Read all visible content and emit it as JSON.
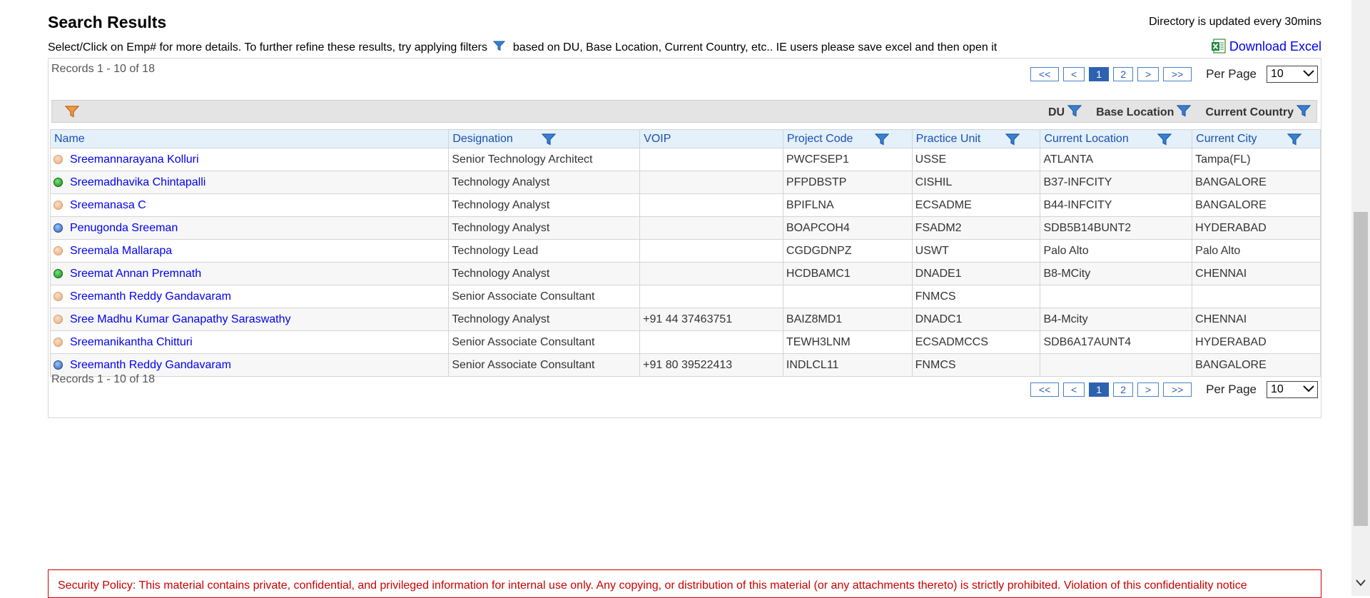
{
  "header": {
    "title": "Search Results",
    "updated_note": "Directory is updated every 30mins",
    "instructions_before": "Select/Click on Emp# for more details. To further refine these results, try applying filters",
    "instructions_after": "based on DU, Base Location, Current Country, etc.. IE users please save excel and then open it",
    "download_label": "Download Excel"
  },
  "pagination": {
    "records_text": "Records 1 - 10 of 18",
    "first": "<<",
    "prev": "<",
    "pages": [
      "1",
      "2"
    ],
    "active_page": "1",
    "next": ">",
    "last": ">>",
    "per_page_label": "Per Page",
    "per_page_value": "10"
  },
  "filter_bar": {
    "labels": [
      "DU",
      "Base Location",
      "Current Country"
    ]
  },
  "table": {
    "columns": [
      "Name",
      "Designation",
      "VOIP",
      "Project Code",
      "Practice Unit",
      "Current Location",
      "Current City"
    ],
    "rows": [
      {
        "status": "away",
        "name": "Sreemannarayana Kolluri",
        "designation": "Senior Technology Architect",
        "voip": "",
        "project": "PWCFSEP1",
        "unit": "USSE",
        "location": "ATLANTA",
        "city": "Tampa(FL)"
      },
      {
        "status": "online",
        "name": "Sreemadhavika Chintapalli",
        "designation": "Technology Analyst",
        "voip": "",
        "project": "PFPDBSTP",
        "unit": "CISHIL",
        "location": "B37-INFCITY",
        "city": "BANGALORE"
      },
      {
        "status": "away",
        "name": "Sreemanasa C",
        "designation": "Technology Analyst",
        "voip": "",
        "project": "BPIFLNA",
        "unit": "ECSADME",
        "location": "B44-INFCITY",
        "city": "BANGALORE"
      },
      {
        "status": "mobile",
        "name": "Penugonda Sreeman",
        "designation": "Technology Analyst",
        "voip": "",
        "project": "BOAPCOH4",
        "unit": "FSADM2",
        "location": "SDB5B14BUNT2",
        "city": "HYDERABAD"
      },
      {
        "status": "away",
        "name": "Sreemala Mallarapa",
        "designation": "Technology Lead",
        "voip": "",
        "project": "CGDGDNPZ",
        "unit": "USWT",
        "location": "Palo Alto",
        "city": "Palo Alto"
      },
      {
        "status": "online",
        "name": "Sreemat Annan Premnath",
        "designation": "Technology Analyst",
        "voip": "",
        "project": "HCDBAMC1",
        "unit": "DNADE1",
        "location": "B8-MCity",
        "city": "CHENNAI"
      },
      {
        "status": "away",
        "name": "Sreemanth Reddy Gandavaram",
        "designation": "Senior Associate Consultant",
        "voip": "",
        "project": "",
        "unit": "FNMCS",
        "location": "",
        "city": ""
      },
      {
        "status": "away",
        "name": "Sree Madhu Kumar Ganapathy Saraswathy",
        "designation": "Technology Analyst",
        "voip": "+91 44 37463751",
        "project": "BAIZ8MD1",
        "unit": "DNADC1",
        "location": "B4-Mcity",
        "city": "CHENNAI"
      },
      {
        "status": "away",
        "name": "Sreemanikantha Chitturi",
        "designation": "Senior Associate Consultant",
        "voip": "",
        "project": "TEWH3LNM",
        "unit": "ECSADMCCS",
        "location": "SDB6A17AUNT4",
        "city": "HYDERABAD"
      },
      {
        "status": "mobile",
        "name": "Sreemanth Reddy Gandavaram",
        "designation": "Senior Associate Consultant",
        "voip": "+91 80 39522413",
        "project": "INDLCL11",
        "unit": "FNMCS",
        "location": "",
        "city": "BANGALORE"
      }
    ]
  },
  "security": {
    "text": "Security Policy: This material contains private, confidential, and privileged information for internal use only. Any copying, or distribution of this material (or any attachments thereto) is strictly prohibited. Violation of this confidentiality notice"
  },
  "colors": {
    "link": "#0000ee",
    "header_bg": "#e4f0fa",
    "header_text": "#1a4fb0",
    "filter_blue": "#3a7fd0",
    "filter_orange": "#e07a1e",
    "security_red": "#cc0000",
    "active_page": "#2d62b0"
  }
}
